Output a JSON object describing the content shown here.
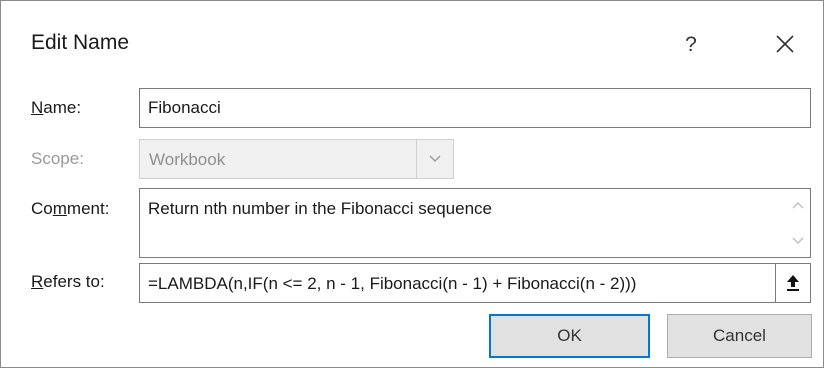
{
  "dialog": {
    "title": "Edit Name",
    "help_glyph": "?",
    "close_icon": "close-icon"
  },
  "form": {
    "name_label_accel": "N",
    "name_label_rest": "ame:",
    "name_value": "Fibonacci",
    "scope_label": "Scope:",
    "scope_value": "Workbook",
    "comment_label_pre": "Co",
    "comment_label_accel": "m",
    "comment_label_post": "ment:",
    "comment_value": "Return nth number in the Fibonacci sequence",
    "refers_label_accel": "R",
    "refers_label_rest": "efers to:",
    "refers_value": "=LAMBDA(n,IF(n <= 2, n - 1, Fibonacci(n - 1) + Fibonacci(n - 2)))"
  },
  "buttons": {
    "ok_label": "OK",
    "cancel_label": "Cancel"
  },
  "colors": {
    "ok_focus_border": "#0078d7",
    "button_bg": "#e1e1e1",
    "disabled_text": "#9a9a9a"
  }
}
